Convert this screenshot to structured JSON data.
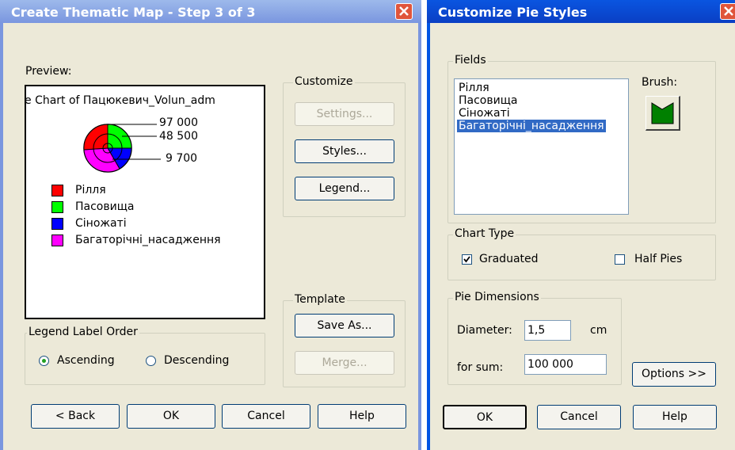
{
  "left_dialog": {
    "title": "Create Thematic Map - Step 3 of 3",
    "preview_label": "Preview:",
    "preview": {
      "chart_title": "e Chart of Пацюкевич_Volun_adm",
      "values": [
        "97 000",
        "48 500",
        "9 700"
      ],
      "legend": [
        {
          "label": "Рілля",
          "color": "#ff0000"
        },
        {
          "label": "Пасовища",
          "color": "#00ff00"
        },
        {
          "label": "Сіножаті",
          "color": "#0000ff"
        },
        {
          "label": "Багаторічні_насадження",
          "color": "#ff00ff"
        }
      ]
    },
    "customize": {
      "label": "Customize",
      "settings": "Settings...",
      "styles": "Styles...",
      "legend": "Legend..."
    },
    "template": {
      "label": "Template",
      "save_as": "Save As...",
      "merge": "Merge..."
    },
    "legend_order": {
      "label": "Legend Label Order",
      "ascending": "Ascending",
      "descending": "Descending",
      "selected": "Ascending"
    },
    "buttons": {
      "back": "< Back",
      "ok": "OK",
      "cancel": "Cancel",
      "help": "Help"
    }
  },
  "right_dialog": {
    "title": "Customize Pie Styles",
    "fields": {
      "label": "Fields",
      "items": [
        "Рілля",
        "Пасовища",
        "Сіножаті",
        "Багаторічні_насадження"
      ],
      "selected_index": 3
    },
    "brush_label": "Brush:",
    "brush_color": "#008000",
    "chart_type": {
      "label": "Chart Type",
      "graduated": "Graduated",
      "graduated_checked": true,
      "half_pies": "Half Pies",
      "half_pies_checked": false
    },
    "pie_dimensions": {
      "label": "Pie Dimensions",
      "diameter_label": "Diameter:",
      "diameter_value": "1,5",
      "diameter_unit": "cm",
      "sum_label": "for sum:",
      "sum_value": "100 000"
    },
    "options_button": "Options >>",
    "buttons": {
      "ok": "OK",
      "cancel": "Cancel",
      "help": "Help"
    }
  },
  "colors": {
    "title_active": "#0a246a",
    "title_inactive": "#7a96df",
    "dialog_bg": "#ece9d8",
    "selection": "#316ac5"
  }
}
